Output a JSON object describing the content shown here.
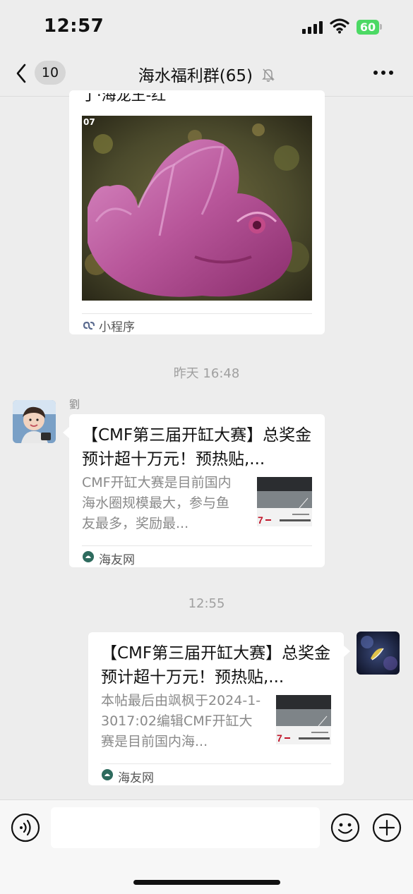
{
  "status_bar": {
    "time": "12:57",
    "battery": "60"
  },
  "nav": {
    "back_count": "10",
    "title": "海水福利群(65)"
  },
  "messages": {
    "card1": {
      "title_fragment": "丁·海龙王-红",
      "image_label": "07",
      "source": "小程序"
    },
    "timestamp1": "昨天 16:48",
    "msg2": {
      "sender": "劉",
      "title": "【CMF第三届开缸大赛】总奖金预计超十万元！预热贴,...",
      "desc": "CMF开缸大赛是目前国内海水圈规模最大，参与鱼友最多，奖励最...",
      "source": "海友网"
    },
    "timestamp2": "12:55",
    "msg3": {
      "title": "【CMF第三届开缸大赛】总奖金预计超十万元！预热贴,...",
      "desc": "本帖最后由飒枫于2024-1-3017:02编辑CMF开缸大赛是目前国内海...",
      "source": "海友网"
    }
  },
  "colors": {
    "background": "#ededed",
    "card": "#ffffff",
    "battery": "#4cd964",
    "muted": "#a0a0a0"
  },
  "icons": [
    "chevron-left-icon",
    "mute-bell-icon",
    "more-icon",
    "mini-program-icon",
    "haiyou-logo-icon",
    "voice-icon",
    "emoji-icon",
    "plus-icon"
  ]
}
